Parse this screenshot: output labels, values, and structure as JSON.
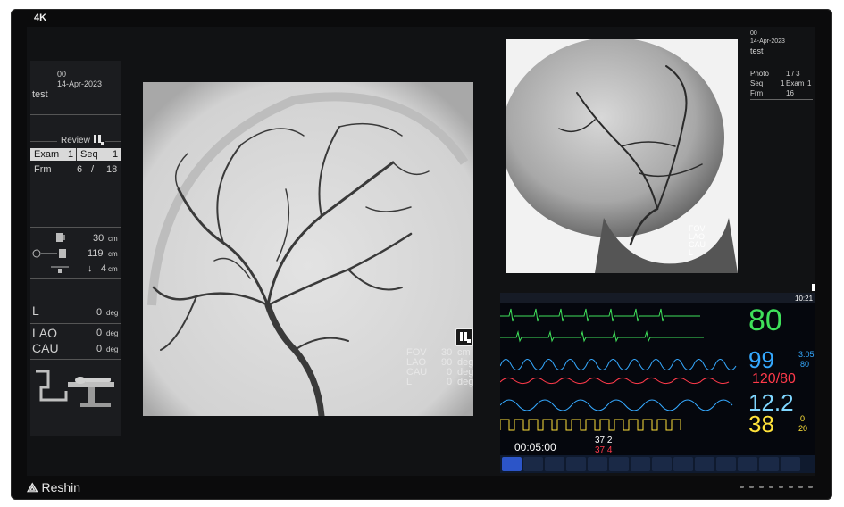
{
  "badge": "4K",
  "brand": "Reshin",
  "left_panel": {
    "id": "00",
    "date": "14-Apr-2023",
    "name": "test",
    "review_label": "Review",
    "exam_label": "Exam",
    "exam_value": "1",
    "seq_label": "Seq",
    "seq_value": "1",
    "frm_label": "Frm",
    "frm_value": "6",
    "frm_sep": "/",
    "frm_total": "18",
    "dist1_value": "30",
    "dist1_unit": "cm",
    "dist2_value": "119",
    "dist2_unit": "cm",
    "dist3_value": "4",
    "dist3_unit": "cm",
    "l_label": "L",
    "l_value": "0",
    "lao_label": "LAO",
    "lao_value": "0",
    "cau_label": "CAU",
    "cau_value": "0",
    "deg_unit": "deg"
  },
  "main_overlay": {
    "fov_label": "FOV",
    "fov_value": "30",
    "fov_unit": "cm",
    "lao_label": "LAO",
    "lao_value": "90",
    "lao_unit": "deg",
    "cau_label": "CAU",
    "cau_value": "0",
    "cau_unit": "deg",
    "l_label": "L",
    "l_value": "0",
    "l_unit": "deg"
  },
  "ref_overlay": {
    "fov_label": "FOV",
    "lao_label": "LAO",
    "cau_label": "CAU",
    "l_label": "L"
  },
  "right_info": {
    "id": "00",
    "date": "14-Apr-2023",
    "name": "test",
    "photo_label": "Photo",
    "photo_value": "1 / 3",
    "seq_label": "Seq",
    "seq_value": "1",
    "exam_label": "Exam",
    "exam_value": "1",
    "frm_label": "Frm",
    "frm_value": "16"
  },
  "monitor": {
    "time": "10:21",
    "hr": "80",
    "spo2": "99",
    "spo2_side1": "3.05",
    "spo2_side2": "80",
    "nibp": "120/80",
    "resp": "12.2",
    "temp": "38",
    "temp_side1": "0",
    "temp_side2": "20",
    "timer": "00:05:00",
    "t1": "37.2",
    "t2": "37.4"
  },
  "colors": {
    "hr": "#3fe05a",
    "spo2": "#35a9ff",
    "nibp": "#ff3a4a",
    "resp": "#7fd6ff",
    "temp": "#ffe23a"
  }
}
